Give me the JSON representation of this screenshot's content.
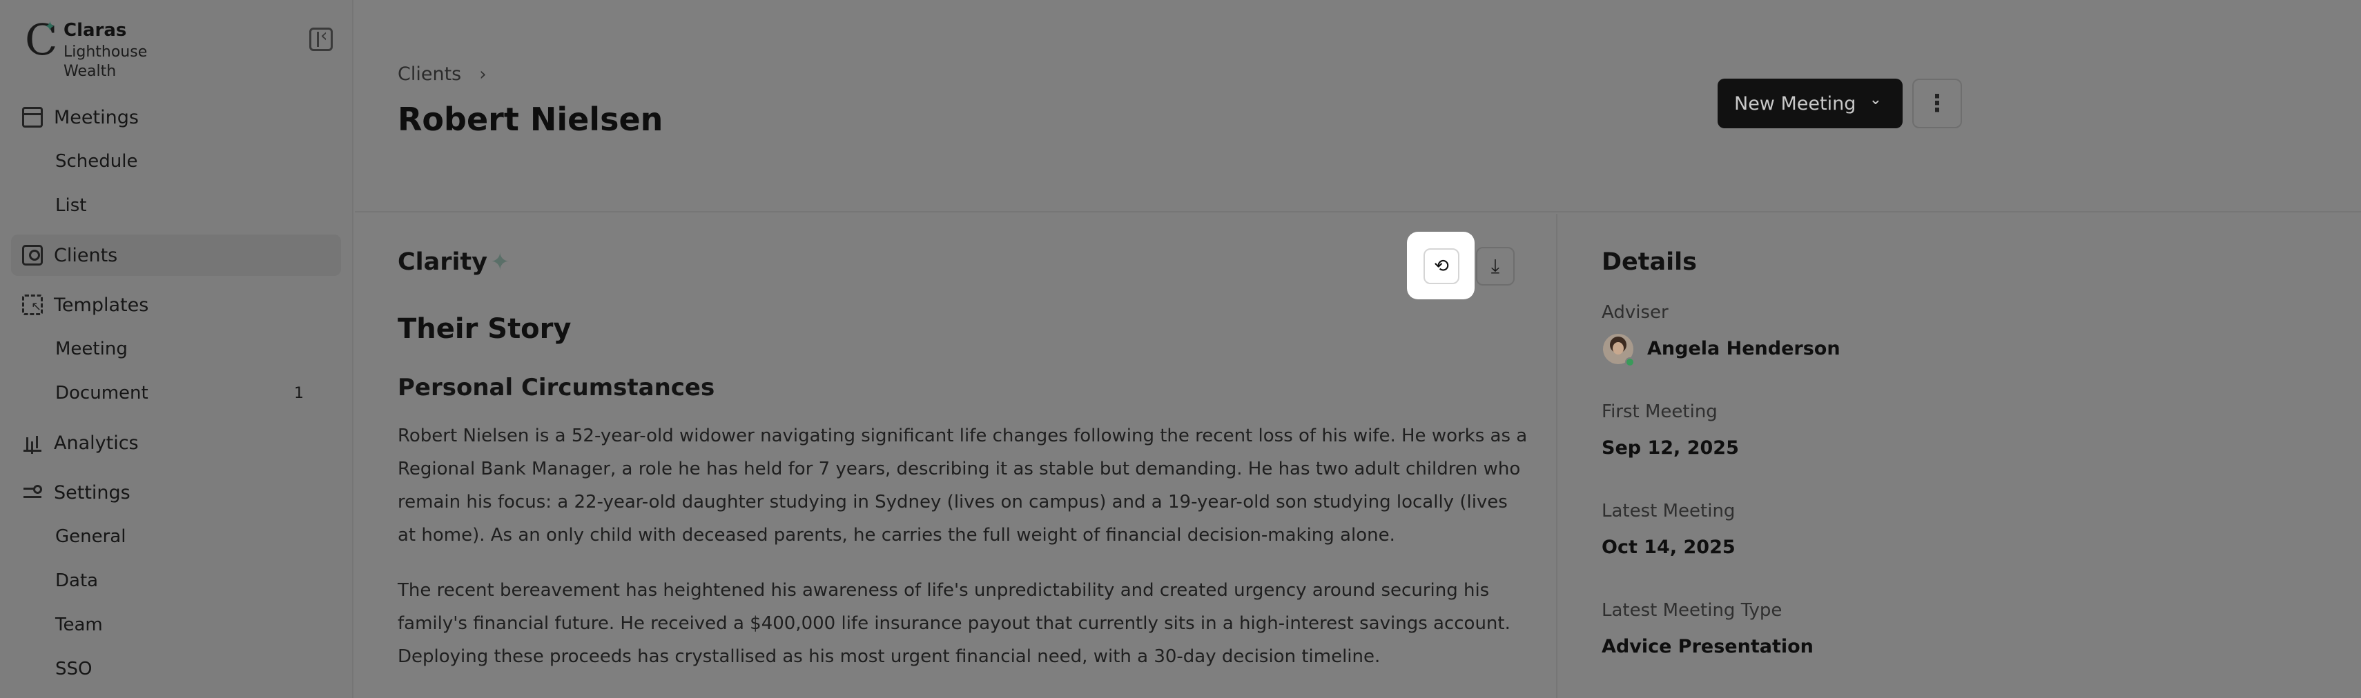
{
  "brand": {
    "name": "Claras",
    "org": "Lighthouse Wealth"
  },
  "sidebar": {
    "meetings": {
      "label": "Meetings",
      "children": [
        "Schedule",
        "List"
      ]
    },
    "clients": {
      "label": "Clients"
    },
    "templates": {
      "label": "Templates",
      "children": [
        "Meeting",
        "Document"
      ],
      "document_count": "1"
    },
    "analytics": {
      "label": "Analytics"
    },
    "settings": {
      "label": "Settings",
      "children": [
        "General",
        "Data",
        "Team",
        "SSO"
      ]
    }
  },
  "header": {
    "breadcrumb": "Clients",
    "title": "Robert Nielsen",
    "new_meeting_label": "New Meeting"
  },
  "main": {
    "clarity_title": "Clarity",
    "story_title": "Their Story",
    "section_title": "Personal Circumstances",
    "paragraphs": [
      "Robert Nielsen is a 52-year-old widower navigating significant life changes following the recent loss of his wife. He works as a Regional Bank Manager, a role he has held for 7 years, describing it as stable but demanding. He has two adult children who remain his focus: a 22-year-old daughter studying in Sydney (lives on campus) and a 19-year-old son studying locally (lives at home). As an only child with deceased parents, he carries the full weight of financial decision-making alone.",
      "The recent bereavement has heightened his awareness of life's unpredictability and created urgency around securing his family's financial future. He received a $400,000 life insurance payout that currently sits in a high-interest savings account. Deploying these proceeds has crystallised as his most urgent financial need, with a 30-day decision timeline."
    ]
  },
  "details": {
    "title": "Details",
    "adviser_label": "Adviser",
    "adviser_name": "Angela Henderson",
    "first_meeting_label": "First Meeting",
    "first_meeting_value": "Sep 12, 2025",
    "latest_meeting_label": "Latest Meeting",
    "latest_meeting_value": "Oct 14, 2025",
    "latest_type_label": "Latest Meeting Type",
    "latest_type_value": "Advice Presentation"
  },
  "icons": {
    "logo": "claras-logo",
    "history": "history-icon",
    "download": "download-icon",
    "more": "more-vertical-icon",
    "collapse": "sidebar-collapse-icon"
  },
  "colors": {
    "highlight": "#ffffff",
    "primary_button": "#111111",
    "online": "#3a9a5a"
  }
}
